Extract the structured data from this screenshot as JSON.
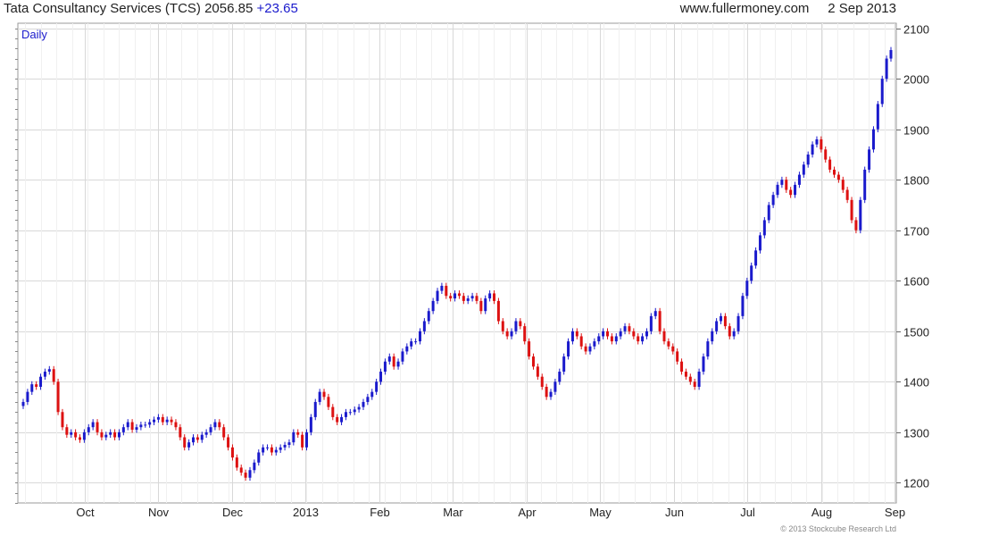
{
  "header": {
    "name": "Tata Consultancy Services (TCS)",
    "price": "2056.85",
    "change": "+23.65",
    "site": "www.fullermoney.com",
    "date": "2 Sep 2013"
  },
  "chart_data": {
    "type": "candlestick",
    "period_label": "Daily",
    "copyright": "© 2013 Stockcube Research Ltd",
    "x_ticks": [
      "Oct",
      "Nov",
      "Dec",
      "2013",
      "Feb",
      "Mar",
      "Apr",
      "May",
      "Jun",
      "Jul",
      "Aug",
      "Sep"
    ],
    "y_ticks": [
      1200,
      1300,
      1400,
      1500,
      1600,
      1700,
      1800,
      1900,
      2000,
      2100
    ],
    "ylim": [
      1160,
      2110
    ],
    "grid": true,
    "up_color": "#1a1acc",
    "down_color": "#dd1111",
    "closes": [
      1360,
      1380,
      1395,
      1390,
      1410,
      1420,
      1425,
      1400,
      1340,
      1310,
      1295,
      1300,
      1290,
      1285,
      1300,
      1310,
      1320,
      1300,
      1290,
      1295,
      1300,
      1290,
      1300,
      1310,
      1320,
      1305,
      1310,
      1315,
      1315,
      1320,
      1325,
      1330,
      1320,
      1325,
      1320,
      1310,
      1290,
      1270,
      1280,
      1290,
      1285,
      1295,
      1300,
      1310,
      1320,
      1310,
      1290,
      1270,
      1250,
      1230,
      1220,
      1210,
      1225,
      1240,
      1260,
      1270,
      1270,
      1260,
      1265,
      1270,
      1275,
      1280,
      1300,
      1295,
      1270,
      1300,
      1330,
      1360,
      1380,
      1370,
      1350,
      1330,
      1320,
      1330,
      1340,
      1340,
      1345,
      1350,
      1360,
      1370,
      1380,
      1400,
      1420,
      1440,
      1450,
      1430,
      1440,
      1460,
      1470,
      1480,
      1480,
      1500,
      1520,
      1540,
      1560,
      1580,
      1590,
      1570,
      1565,
      1575,
      1570,
      1560,
      1565,
      1570,
      1560,
      1540,
      1565,
      1575,
      1560,
      1520,
      1500,
      1490,
      1500,
      1520,
      1510,
      1480,
      1450,
      1430,
      1410,
      1390,
      1370,
      1380,
      1400,
      1420,
      1450,
      1480,
      1500,
      1490,
      1470,
      1460,
      1470,
      1480,
      1490,
      1500,
      1490,
      1480,
      1490,
      1500,
      1510,
      1500,
      1490,
      1480,
      1490,
      1500,
      1530,
      1540,
      1500,
      1480,
      1470,
      1460,
      1440,
      1420,
      1410,
      1400,
      1390,
      1420,
      1450,
      1480,
      1500,
      1520,
      1530,
      1510,
      1490,
      1500,
      1530,
      1570,
      1600,
      1630,
      1660,
      1690,
      1720,
      1750,
      1770,
      1790,
      1800,
      1780,
      1770,
      1790,
      1810,
      1830,
      1850,
      1870,
      1880,
      1860,
      1840,
      1820,
      1810,
      1800,
      1780,
      1760,
      1720,
      1700,
      1760,
      1820,
      1860,
      1900,
      1950,
      2000,
      2040,
      2056.85
    ]
  }
}
